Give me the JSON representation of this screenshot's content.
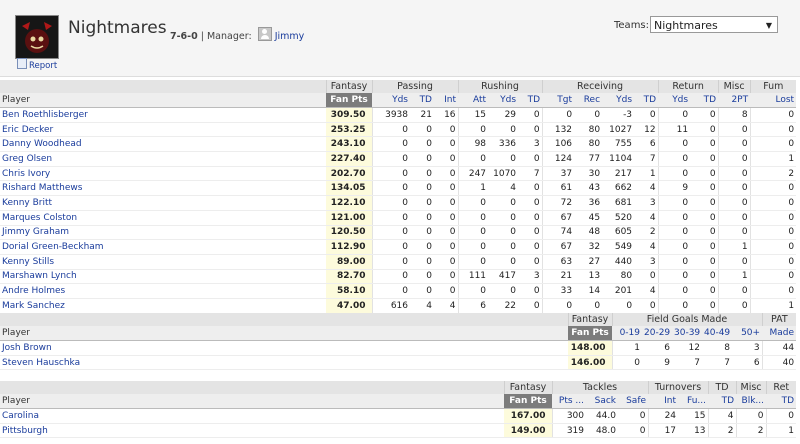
{
  "team": {
    "name": "Nightmares",
    "record": "7-6-0",
    "manager_label": "Manager:",
    "manager": "Jimmy",
    "report_link": "Report",
    "teams_label": "Teams:",
    "teams_selected": "Nightmares",
    "separator": "|"
  },
  "offense": {
    "groups": [
      "Fantasy",
      "Passing",
      "Rushing",
      "Receiving",
      "Return",
      "Misc",
      "Fum"
    ],
    "columns": [
      "Player",
      "Fan Pts",
      "Yds",
      "TD",
      "Int",
      "Att",
      "Yds",
      "TD",
      "Tgt",
      "Rec",
      "Yds",
      "TD",
      "Yds",
      "TD",
      "2PT",
      "Lost"
    ],
    "rows": [
      [
        "Ben Roethlisberger",
        "309.50",
        "3938",
        "21",
        "16",
        "15",
        "29",
        "0",
        "0",
        "0",
        "-3",
        "0",
        "0",
        "0",
        "8",
        "0"
      ],
      [
        "Eric Decker",
        "253.25",
        "0",
        "0",
        "0",
        "0",
        "0",
        "0",
        "132",
        "80",
        "1027",
        "12",
        "11",
        "0",
        "0",
        "0"
      ],
      [
        "Danny Woodhead",
        "243.10",
        "0",
        "0",
        "0",
        "98",
        "336",
        "3",
        "106",
        "80",
        "755",
        "6",
        "0",
        "0",
        "0",
        "0"
      ],
      [
        "Greg Olsen",
        "227.40",
        "0",
        "0",
        "0",
        "0",
        "0",
        "0",
        "124",
        "77",
        "1104",
        "7",
        "0",
        "0",
        "0",
        "1"
      ],
      [
        "Chris Ivory",
        "202.70",
        "0",
        "0",
        "0",
        "247",
        "1070",
        "7",
        "37",
        "30",
        "217",
        "1",
        "0",
        "0",
        "0",
        "2"
      ],
      [
        "Rishard Matthews",
        "134.05",
        "0",
        "0",
        "0",
        "1",
        "4",
        "0",
        "61",
        "43",
        "662",
        "4",
        "9",
        "0",
        "0",
        "0"
      ],
      [
        "Kenny Britt",
        "122.10",
        "0",
        "0",
        "0",
        "0",
        "0",
        "0",
        "72",
        "36",
        "681",
        "3",
        "0",
        "0",
        "0",
        "0"
      ],
      [
        "Marques Colston",
        "121.00",
        "0",
        "0",
        "0",
        "0",
        "0",
        "0",
        "67",
        "45",
        "520",
        "4",
        "0",
        "0",
        "0",
        "0"
      ],
      [
        "Jimmy Graham",
        "120.50",
        "0",
        "0",
        "0",
        "0",
        "0",
        "0",
        "74",
        "48",
        "605",
        "2",
        "0",
        "0",
        "0",
        "0"
      ],
      [
        "Dorial Green-Beckham",
        "112.90",
        "0",
        "0",
        "0",
        "0",
        "0",
        "0",
        "67",
        "32",
        "549",
        "4",
        "0",
        "0",
        "1",
        "0"
      ],
      [
        "Kenny Stills",
        "89.00",
        "0",
        "0",
        "0",
        "0",
        "0",
        "0",
        "63",
        "27",
        "440",
        "3",
        "0",
        "0",
        "0",
        "0"
      ],
      [
        "Marshawn Lynch",
        "82.70",
        "0",
        "0",
        "0",
        "111",
        "417",
        "3",
        "21",
        "13",
        "80",
        "0",
        "0",
        "0",
        "1",
        "0"
      ],
      [
        "Andre Holmes",
        "58.10",
        "0",
        "0",
        "0",
        "0",
        "0",
        "0",
        "33",
        "14",
        "201",
        "4",
        "0",
        "0",
        "0",
        "0"
      ],
      [
        "Mark Sanchez",
        "47.00",
        "616",
        "4",
        "4",
        "6",
        "22",
        "0",
        "0",
        "0",
        "0",
        "0",
        "0",
        "0",
        "0",
        "1"
      ]
    ]
  },
  "kickers": {
    "groups": [
      "Fantasy",
      "Field Goals Made",
      "PAT"
    ],
    "columns": [
      "Player",
      "Fan Pts",
      "0-19",
      "20-29",
      "30-39",
      "40-49",
      "50+",
      "Made"
    ],
    "rows": [
      [
        "Josh Brown",
        "148.00",
        "1",
        "6",
        "12",
        "8",
        "3",
        "44"
      ],
      [
        "Steven Hauschka",
        "146.00",
        "0",
        "9",
        "7",
        "7",
        "6",
        "40"
      ]
    ]
  },
  "defense": {
    "groups": [
      "Fantasy",
      "Tackles",
      "Turnovers",
      "TD",
      "Misc",
      "Ret"
    ],
    "columns": [
      "Player",
      "Fan Pts",
      "Pts ...",
      "Sack",
      "Safe",
      "Int",
      "Fu...",
      "TD",
      "Blk...",
      "TD"
    ],
    "rows": [
      [
        "Carolina",
        "167.00",
        "300",
        "44.0",
        "0",
        "24",
        "15",
        "4",
        "0",
        "0"
      ],
      [
        "Pittsburgh",
        "149.00",
        "319",
        "48.0",
        "0",
        "17",
        "13",
        "2",
        "2",
        "1"
      ]
    ]
  },
  "colors": {
    "link": "#1a3c9c",
    "fan_pts_header": "#7c7c7c",
    "fan_pts_cell": "#fdfbdc",
    "header_bg": "#e4e4e4"
  }
}
